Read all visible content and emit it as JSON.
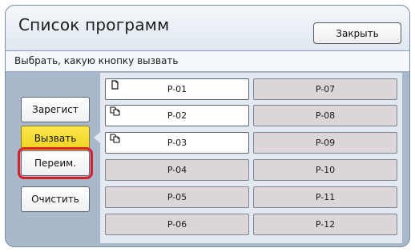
{
  "header": {
    "title": "Список программ",
    "close_label": "Закрыть"
  },
  "instruction": "Выбрать, какую кнопку вызвать",
  "side_buttons": [
    {
      "id": "register",
      "label": "Зарегист",
      "active": false
    },
    {
      "id": "call",
      "label": "Вызвать",
      "active": true
    },
    {
      "id": "rename",
      "label": "Переим.",
      "active": false,
      "highlighted": true
    },
    {
      "id": "clear",
      "label": "Очистить",
      "active": false
    }
  ],
  "programs": [
    {
      "label": "P-01",
      "registered": true,
      "icon": "single-document-icon"
    },
    {
      "label": "P-02",
      "registered": true,
      "icon": "multi-document-icon"
    },
    {
      "label": "P-03",
      "registered": true,
      "icon": "multi-document-icon"
    },
    {
      "label": "P-04",
      "registered": false
    },
    {
      "label": "P-05",
      "registered": false
    },
    {
      "label": "P-06",
      "registered": false
    },
    {
      "label": "P-07",
      "registered": false
    },
    {
      "label": "P-08",
      "registered": false
    },
    {
      "label": "P-09",
      "registered": false
    },
    {
      "label": "P-10",
      "registered": false
    },
    {
      "label": "P-11",
      "registered": false
    },
    {
      "label": "P-12",
      "registered": false
    }
  ],
  "colors": {
    "active_yellow": "#f5dc2e",
    "highlight_red": "#d8202b",
    "panel_blue": "#a9b8ca",
    "empty_slot": "#dcd6da"
  }
}
